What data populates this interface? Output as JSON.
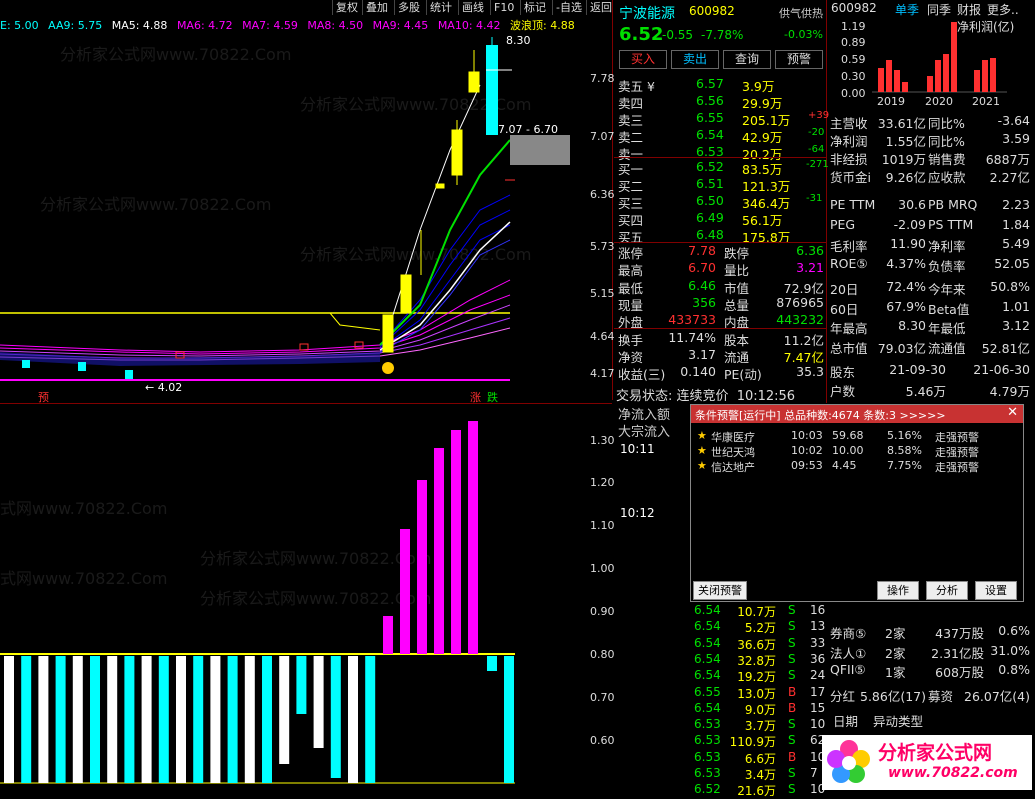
{
  "menu": [
    "复权",
    "叠加",
    "多股",
    "统计",
    "画线",
    "F10",
    "标记",
    "-自选",
    "返回"
  ],
  "ma_legend": [
    {
      "label": "MA5: 4.88",
      "color": "#ffffff"
    },
    {
      "label": "MA6: 4.72",
      "color": "#ff00ff"
    },
    {
      "label": "MA7: 4.59",
      "color": "#ff00ff"
    },
    {
      "label": "MA8: 4.50",
      "color": "#ff00ff"
    },
    {
      "label": "MA9: 4.45",
      "color": "#ff00ff"
    },
    {
      "label": "MA10: 4.42",
      "color": "#ff00ff"
    },
    {
      "label": "波浪顶: 4.88",
      "color": "#ffff00"
    }
  ],
  "ma_legend_prefix": [
    "E: 5.00",
    "AA9: 5.75"
  ],
  "price_axis": [
    "7.78",
    "7.07",
    "6.36",
    "5.73",
    "5.15",
    "4.64",
    "4.17"
  ],
  "sub_axis": [
    "1.30",
    "1.20",
    "1.10",
    "1.00",
    "0.90",
    "0.80",
    "0.70",
    "0.60"
  ],
  "chart_annotations": {
    "high": "8.30",
    "range": "7.07 - 6.70",
    "low": "← 4.02",
    "yu": "预",
    "zhang": "涨",
    "die": "跌"
  },
  "stock": {
    "name": "宁波能源",
    "code": "600982",
    "price": "6.52",
    "change": "-0.55",
    "pct": "-7.78%",
    "supply_label": "供气供热",
    "supply_pct": "-0.03%"
  },
  "actions": [
    "买入",
    "卖出",
    "查询",
    "预警"
  ],
  "sells": [
    {
      "label": "卖五 ¥",
      "price": "6.57",
      "vol": "3.9万",
      "chg": ""
    },
    {
      "label": "卖四",
      "price": "6.56",
      "vol": "29.9万",
      "chg": ""
    },
    {
      "label": "卖三",
      "price": "6.55",
      "vol": "205.1万",
      "chg": "+39"
    },
    {
      "label": "卖二",
      "price": "6.54",
      "vol": "42.9万",
      "chg": "-20"
    },
    {
      "label": "卖一",
      "price": "6.53",
      "vol": "20.2万",
      "chg": "-64"
    }
  ],
  "buys": [
    {
      "label": "买一",
      "price": "6.52",
      "vol": "83.5万",
      "chg": "-271"
    },
    {
      "label": "买二",
      "price": "6.51",
      "vol": "121.3万",
      "chg": ""
    },
    {
      "label": "买三",
      "price": "6.50",
      "vol": "346.4万",
      "chg": "-31"
    },
    {
      "label": "买四",
      "price": "6.49",
      "vol": "56.1万",
      "chg": ""
    },
    {
      "label": "买五",
      "price": "6.48",
      "vol": "175.8万",
      "chg": ""
    }
  ],
  "quote_rows": [
    {
      "l1": "涨停",
      "v1": "7.78",
      "l2": "跌停",
      "v2": "6.36"
    },
    {
      "l1": "最高",
      "v1": "6.70",
      "l2": "量比",
      "v2": "3.21"
    },
    {
      "l1": "最低",
      "v1": "6.46",
      "l2": "市值",
      "v2": "72.9亿"
    },
    {
      "l1": "现量",
      "v1": "356",
      "l2": "总量",
      "v2": "876965"
    },
    {
      "l1": "外盘",
      "v1": "433733",
      "l2": "内盘",
      "v2": "443232"
    },
    {
      "l1": "换手",
      "v1": "11.74%",
      "l2": "股本",
      "v2": "11.2亿"
    },
    {
      "l1": "净资",
      "v1": "3.17",
      "l2": "流通",
      "v2": "7.47亿"
    },
    {
      "l1": "收益(三)",
      "v1": "0.140",
      "l2": "PE(动)",
      "v2": "35.3"
    }
  ],
  "trade_status": {
    "label": "交易状态:",
    "value": "连续竞价",
    "time": "10:12:56"
  },
  "flow_labels": [
    "净流入额",
    "大宗流入"
  ],
  "flow_times": [
    "10:11",
    "10:12"
  ],
  "ticks": [
    {
      "p": "6.54",
      "v": "10.7万",
      "s": "S",
      "n": "16"
    },
    {
      "p": "6.54",
      "v": "5.2万",
      "s": "S",
      "n": "13"
    },
    {
      "p": "6.54",
      "v": "36.6万",
      "s": "S",
      "n": "33"
    },
    {
      "p": "6.54",
      "v": "32.8万",
      "s": "S",
      "n": "36"
    },
    {
      "p": "6.54",
      "v": "19.2万",
      "s": "S",
      "n": "24"
    },
    {
      "p": "6.55",
      "v": "13.0万",
      "s": "B",
      "n": "17"
    },
    {
      "p": "6.54",
      "v": "9.0万",
      "s": "B",
      "n": "15"
    },
    {
      "p": "6.53",
      "v": "3.7万",
      "s": "S",
      "n": "10"
    },
    {
      "p": "6.53",
      "v": "110.9万",
      "s": "S",
      "n": "62"
    },
    {
      "p": "6.53",
      "v": "6.6万",
      "s": "B",
      "n": "10"
    },
    {
      "p": "6.53",
      "v": "3.4万",
      "s": "S",
      "n": "7"
    },
    {
      "p": "6.52",
      "v": "21.6万",
      "s": "S",
      "n": "10"
    }
  ],
  "popup": {
    "title": "条件预警[运行中] 总品种数:4674 条数:3 >>>>>",
    "rows": [
      {
        "name": "华康医疗",
        "time": "10:03",
        "price": "59.68",
        "pct": "5.16%",
        "desc": "走强预警"
      },
      {
        "name": "世纪天鸿",
        "time": "10:02",
        "price": "10.00",
        "pct": "8.58%",
        "desc": "走强预警"
      },
      {
        "name": "信达地产",
        "time": "09:53",
        "price": "4.45",
        "pct": "7.75%",
        "desc": "走强预警"
      }
    ],
    "close_btn": "关闭预警",
    "op_btn": "操作",
    "analyze_btn": "分析",
    "settings_btn": "设置"
  },
  "right": {
    "code": "600982",
    "tabs": [
      "单季",
      "同季",
      "财报",
      "更多.."
    ],
    "profit_label": "净利润(亿)",
    "bar_axis": [
      "1.19",
      "0.89",
      "0.59",
      "0.30",
      "0.00"
    ],
    "years": [
      "2019",
      "2020",
      "2021"
    ],
    "fin_rows": [
      {
        "l1": "主营收",
        "v1": "33.61亿",
        "l2": "同比%",
        "v2": "-3.64"
      },
      {
        "l1": "净利润",
        "v1": "1.55亿",
        "l2": "同比%",
        "v2": "3.59"
      },
      {
        "l1": "非经损",
        "v1": "1019万",
        "l2": "销售费",
        "v2": "6887万"
      },
      {
        "l1": "货币金i",
        "v1": "9.26亿",
        "l2": "应收款",
        "v2": "2.27亿"
      }
    ],
    "val_rows": [
      {
        "l1": "PE TTM",
        "v1": "30.6",
        "l2": "PB MRQ",
        "v2": "2.23"
      },
      {
        "l1": "PEG",
        "v1": "-2.09",
        "l2": "PS TTM",
        "v2": "1.84"
      },
      {
        "l1": "毛利率",
        "v1": "11.90",
        "l2": "净利率",
        "v2": "5.49"
      },
      {
        "l1": "ROE⑤",
        "v1": "4.37%",
        "l2": "负债率",
        "v2": "52.05"
      }
    ],
    "perf_rows": [
      {
        "l1": "20日",
        "v1": "72.4%",
        "l2": "今年来",
        "v2": "50.8%"
      },
      {
        "l1": "60日",
        "v1": "67.9%",
        "l2": "Beta值",
        "v2": "1.01"
      },
      {
        "l1": "年最高",
        "v1": "8.30",
        "l2": "年最低",
        "v2": "3.12"
      },
      {
        "l1": "总市值",
        "v1": "79.03亿",
        "l2": "流通值",
        "v2": "52.81亿"
      }
    ],
    "holder_rows": [
      {
        "l1": "股东",
        "v1": "21-09-30",
        "v2": "21-06-30"
      },
      {
        "l1": "户数",
        "v1": "5.46万",
        "v2": "4.79万"
      }
    ],
    "inst_rows": [
      {
        "l1": "券商⑤",
        "v1": "2家",
        "v2": "437万股",
        "v3": "0.6%"
      },
      {
        "l1": "法人①",
        "v1": "2家",
        "v2": "2.31亿股",
        "v3": "31.0%"
      },
      {
        "l1": "QFII⑤",
        "v1": "1家",
        "v2": "608万股",
        "v3": "0.8%"
      }
    ],
    "dividend": {
      "l1": "分红",
      "v1": "5.86亿(17)",
      "l2": "募资",
      "v2": "26.07亿(4)"
    },
    "bottom": [
      "日期",
      "异动类型"
    ]
  },
  "logo": {
    "text": "分析家公式网",
    "url": "www.70822.com"
  },
  "colors": {
    "accent": "#ff00ff",
    "cyan": "#00ffff",
    "yellow": "#ffff00",
    "red": "#ff3030",
    "green": "#00e000"
  }
}
